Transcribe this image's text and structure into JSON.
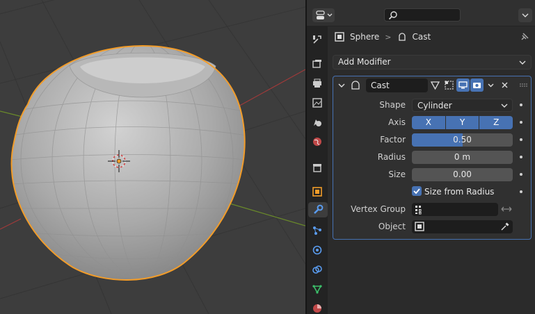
{
  "viewport": {
    "object_name": "Sphere"
  },
  "properties": {
    "breadcrumb": {
      "object": "Sphere",
      "modifier": "Cast"
    },
    "add_modifier_label": "Add Modifier",
    "modifier": {
      "name": "Cast",
      "fields": {
        "shape_label": "Shape",
        "shape_value": "Cylinder",
        "axis_label": "Axis",
        "axis_x": "X",
        "axis_y": "Y",
        "axis_z": "Z",
        "factor_label": "Factor",
        "factor_value": "0.50",
        "factor_fraction": 0.5,
        "radius_label": "Radius",
        "radius_value": "0 m",
        "size_label": "Size",
        "size_value": "0.00",
        "size_from_radius_label": "Size from Radius",
        "size_from_radius_checked": true,
        "vertex_group_label": "Vertex Group",
        "vertex_group_value": "",
        "object_label": "Object",
        "object_value": ""
      }
    },
    "tabs": [
      "tool",
      "render",
      "output",
      "view-layer",
      "scene",
      "world",
      "collection",
      "object",
      "modifiers",
      "particles",
      "physics",
      "constraints",
      "data",
      "material"
    ],
    "active_tab": "modifiers"
  },
  "colors": {
    "accent": "#4772b3",
    "selection_outline": "#f29c29",
    "viewport_bg": "#3d3d3d",
    "panel_bg": "#303030"
  }
}
